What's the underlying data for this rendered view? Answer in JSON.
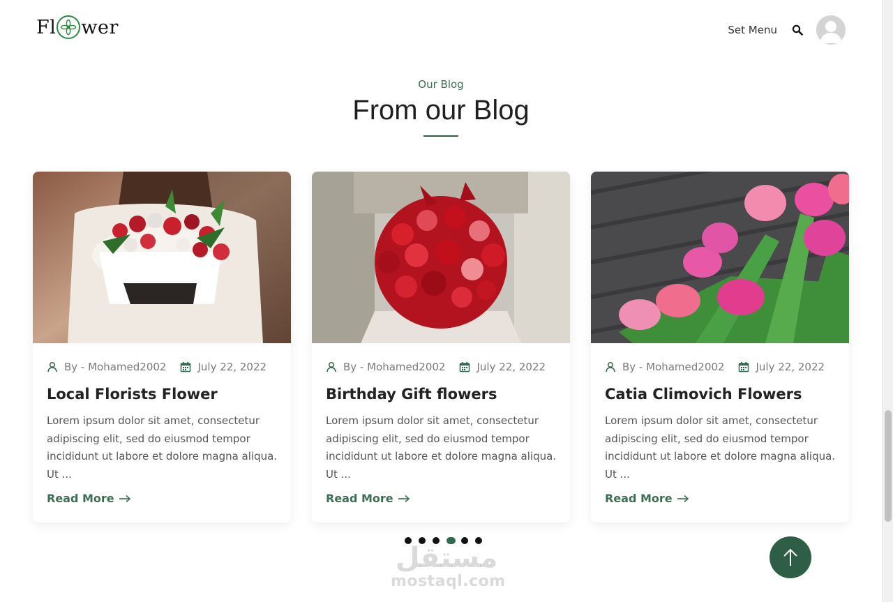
{
  "header": {
    "logo_left": "Fl",
    "logo_right": "wer",
    "set_menu_label": "Set Menu"
  },
  "section": {
    "eyebrow": "Our Blog",
    "title": "From our Blog"
  },
  "posts": [
    {
      "author": "By - Mohamed2002",
      "date": "July 22, 2022",
      "title": "Local Florists Flower",
      "excerpt": "Lorem ipsum dolor sit amet, consectetur adipiscing elit, sed do eiusmod tempor incididunt ut labore et dolore magna aliqua. Ut ...",
      "read_more": "Read More"
    },
    {
      "author": "By - Mohamed2002",
      "date": "July 22, 2022",
      "title": "Birthday Gift flowers",
      "excerpt": "Lorem ipsum dolor sit amet, consectetur adipiscing elit, sed do eiusmod tempor incididunt ut labore et dolore magna aliqua. Ut ...",
      "read_more": "Read More"
    },
    {
      "author": "By - Mohamed2002",
      "date": "July 22, 2022",
      "title": "Catia Climovich Flowers",
      "excerpt": "Lorem ipsum dolor sit amet, consectetur adipiscing elit, sed do eiusmod tempor incididunt ut labore et dolore magna aliqua. Ut ...",
      "read_more": "Read More"
    }
  ],
  "carousel": {
    "dot_count": 6,
    "active_dot": 4
  },
  "watermark": {
    "arabic": "مستقل",
    "latin": "mostaql.com"
  },
  "icons": {
    "search": "search-icon",
    "avatar": "user-avatar",
    "author": "user-icon",
    "date": "calendar-icon",
    "read_more": "arrow-right-icon",
    "to_top": "arrow-up-icon"
  },
  "colors": {
    "accent": "#3b6e52",
    "button": "#2e5e45",
    "logo_ring": "#2a8a3e"
  }
}
